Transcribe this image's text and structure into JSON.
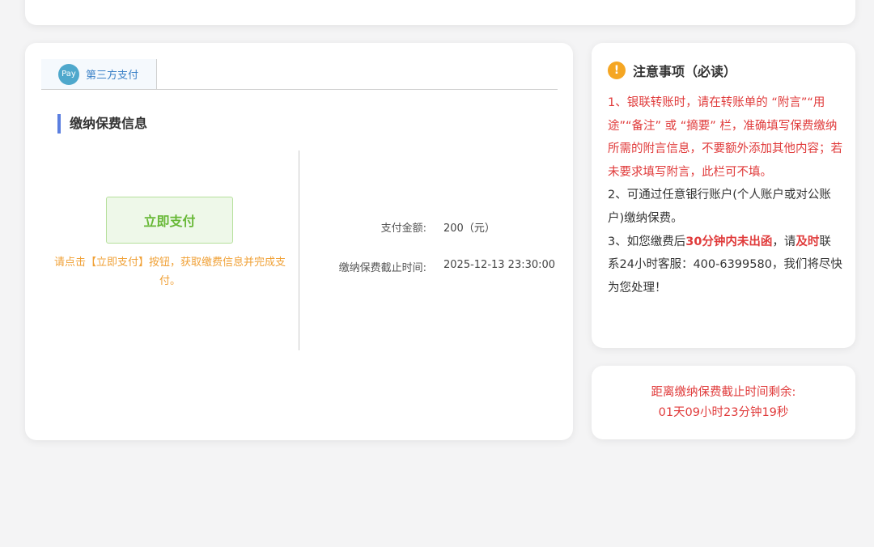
{
  "tab": {
    "icon_text": "Pay",
    "label": "第三方支付"
  },
  "section": {
    "title": "缴纳保费信息"
  },
  "pay": {
    "button_label": "立即支付",
    "hint": "请点击【立即支付】按钮，获取缴费信息并完成支付。"
  },
  "payment": {
    "amount_label": "支付金额:",
    "amount_value": "200（元）",
    "deadline_label": "缴纳保费截止时间:",
    "deadline_value": "2025-12-13 23:30:00"
  },
  "notice": {
    "icon_text": "!",
    "title": "注意事项（必读）",
    "item1": "1、银联转账时，请在转账单的 “附言”“用途”“备注” 或 “摘要” 栏，准确填写保费缴纳所需的附言信息，不要额外添加其他内容；若未要求填写附言，此栏可不填。",
    "item2": "2、可通过任意银行账户(个人账户或对公账户)缴纳保费。",
    "item3_a": "3、如您缴费后",
    "item3_b": "30分钟内未出函",
    "item3_c": "，请",
    "item3_d": "及时",
    "item3_e": "联系24小时客服：400-6399580，我们将尽快为您处理！"
  },
  "countdown": {
    "label": "距离缴纳保费截止时间剩余:",
    "value": "01天09小时23分钟19秒"
  },
  "colors": {
    "accent_blue": "#5b7fe0",
    "pay_green": "#67b836",
    "hint_orange": "#f0a137",
    "warning_red": "#e03b3b",
    "warn_icon": "#f5a623"
  }
}
